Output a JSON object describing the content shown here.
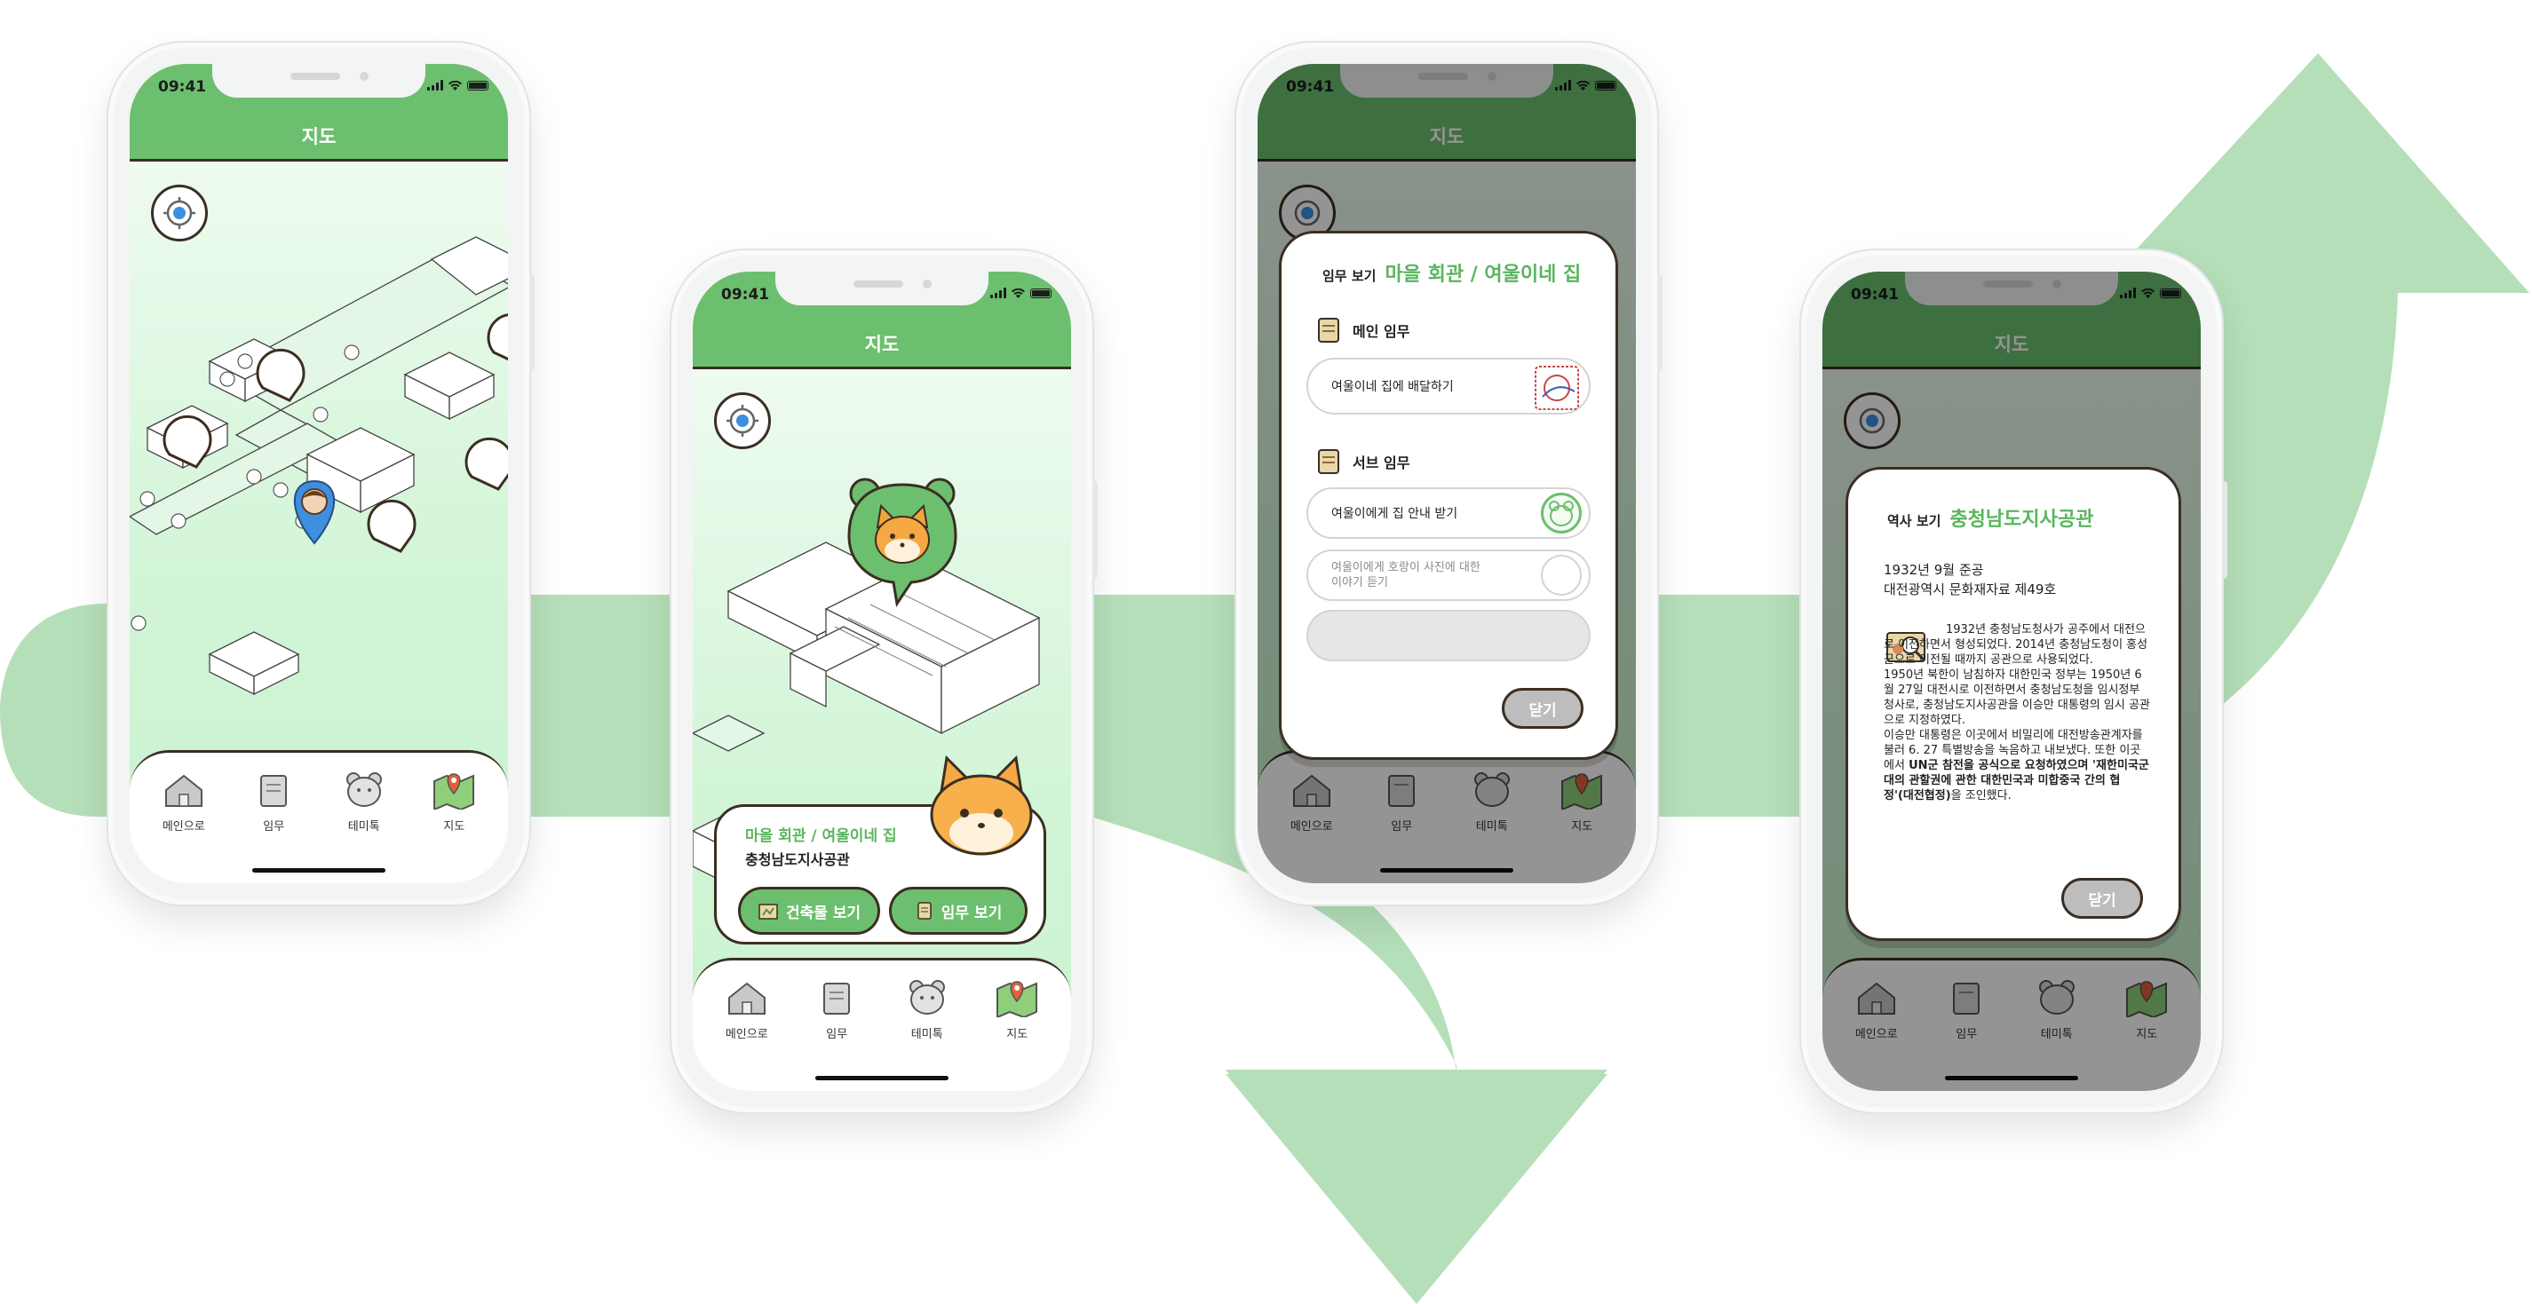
{
  "status": {
    "time": "09:41"
  },
  "appbar": {
    "title": "지도"
  },
  "tabs": [
    {
      "label": "메인으로",
      "icon": "house-icon"
    },
    {
      "label": "임무",
      "icon": "scroll-icon"
    },
    {
      "label": "테미톡",
      "icon": "bear-face-icon"
    },
    {
      "label": "지도",
      "icon": "map-icon"
    }
  ],
  "popup": {
    "subtitle": "마을 회관 / 여울이네 집",
    "building": "충청남도지사공관",
    "building_btn": "건축물 보기",
    "mission_btn": "임무 보기"
  },
  "mission_modal": {
    "label": "임무 보기",
    "title": "마을 회관 / 여울이네 집",
    "main_section": "메인 임무",
    "main_task": "여울이네 집에 배달하기",
    "sub_section": "서브 임무",
    "sub_task_1": "여울이에게 집 안내 받기",
    "sub_task_2_line1": "여울이에게 호랑이 사진에 대한",
    "sub_task_2_line2": "이야기 듣기",
    "close": "닫기"
  },
  "history_modal": {
    "label": "역사 보기",
    "title": "충청남도지사공관",
    "date": "1932년 9월 준공",
    "heritage": "대전광역시 문화재자료 제49호",
    "p1": "1932년 충청남도청사가 공주에서 대전으로 이전하면서 형성되었다. 2014년 충청남도청이 홍성군으로 이전될 때까지 공관으로 사용되었다.",
    "p2": "1950년 북한이 남침하자 대한민국 정부는 1950년 6월 27일 대전시로 이전하면서 충청남도청을 임시정부청사로, 충청남도지사공관을 이승만 대통령의 임시 공관으로 지정하였다.",
    "p3_a": "이승만 대통령은 이곳에서 비밀리에 대전방송관계자를 불러 6. 27 특별방송을 녹음하고 내보냈다. 또한 이곳에서 ",
    "p3_b": "UN군 참전을 공식으로 요청하였으며 '재한미국군대의 관할권에 관한 대한민국과 미합중국 간의 협정'(대전협정)",
    "p3_c": "을 조인했다.",
    "close": "닫기"
  },
  "colors": {
    "accent_green": "#6cbf6e",
    "dark_green_header": "#3f7e43",
    "arrow_bg": "#b5dfb8",
    "outline": "#3b2e22",
    "map_bg": "#d3f5d8",
    "close_btn": "#bdbdbd"
  }
}
